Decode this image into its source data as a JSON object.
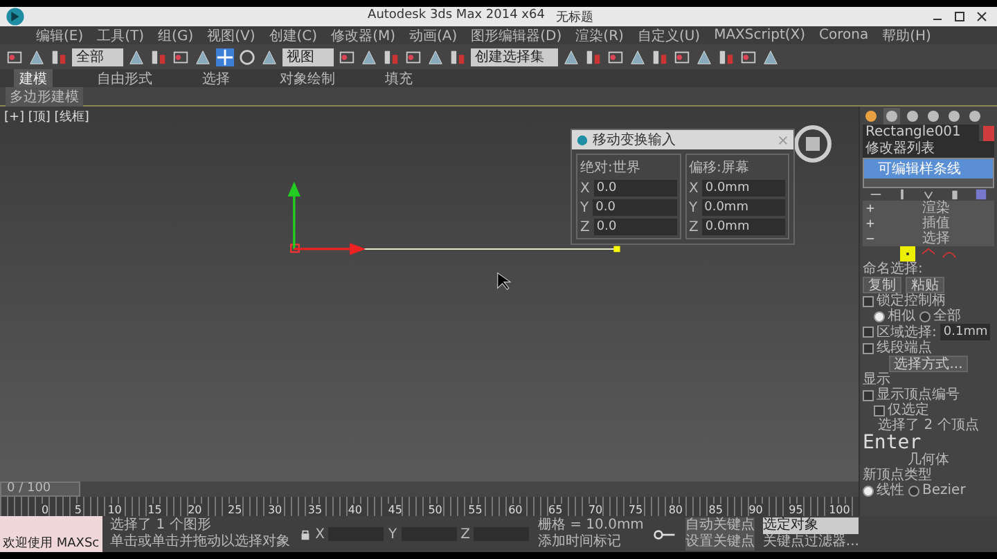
{
  "window": {
    "title": "Autodesk 3ds Max  2014 x64",
    "document": "无标题"
  },
  "menu": [
    "编辑(E)",
    "工具(T)",
    "组(G)",
    "视图(V)",
    "创建(C)",
    "修改器(M)",
    "动画(A)",
    "图形编辑器(D)",
    "渲染(R)",
    "自定义(U)",
    "MAXScript(X)",
    "Corona",
    "帮助(H)"
  ],
  "toolbar": {
    "filter": "全部",
    "coord": "视图",
    "selection_set": "创建选择集"
  },
  "ribbon": {
    "tabs": [
      {
        "label": "建模",
        "selected": true
      },
      {
        "label": "自由形式",
        "selected": false
      },
      {
        "label": "选择",
        "selected": false
      },
      {
        "label": "对象绘制",
        "selected": false
      },
      {
        "label": "填充",
        "selected": false
      }
    ],
    "subtitle": "多边形建模"
  },
  "viewport": {
    "label": "[+] [顶] [线框]"
  },
  "dialog": {
    "title": "移动变换输入",
    "groups": [
      {
        "title": "绝对:世界",
        "fields": [
          {
            "axis": "X",
            "value": "0.0"
          },
          {
            "axis": "Y",
            "value": "0.0"
          },
          {
            "axis": "Z",
            "value": "0.0"
          }
        ]
      },
      {
        "title": "偏移:屏幕",
        "fields": [
          {
            "axis": "X",
            "value": "0.0mm"
          },
          {
            "axis": "Y",
            "value": "0.0mm"
          },
          {
            "axis": "Z",
            "value": "0.0mm"
          }
        ]
      }
    ]
  },
  "panel": {
    "object_name": "Rectangle001",
    "modifier_list": "修改器列表",
    "stack": [
      {
        "label": "可编辑样条线",
        "selected": true
      }
    ],
    "rollouts": [
      {
        "label": "渲染",
        "expanded": false
      },
      {
        "label": "插值",
        "expanded": false
      },
      {
        "label": "选择",
        "expanded": true
      }
    ],
    "named_selection": "命名选择:",
    "copy": "复制",
    "paste": "粘贴",
    "lock_handles": {
      "label": "锁定控制柄",
      "checked": false
    },
    "handle_mode": [
      {
        "label": "相似",
        "selected": true
      },
      {
        "label": "全部",
        "selected": false
      }
    ],
    "area_select": {
      "label": "区域选择:",
      "checked": false,
      "value": "0.1mm"
    },
    "segment_end": {
      "label": "线段端点",
      "checked": false
    },
    "select_by": "选择方式...",
    "display": "显示",
    "show_numbers": {
      "label": "显示顶点编号",
      "checked": false
    },
    "selected_only": {
      "label": "仅选定",
      "checked": false
    },
    "status": "选择了 2 个顶点",
    "key_overlay": "Enter",
    "geometry": "几何体",
    "new_vertex_type": "新顶点类型",
    "vertex_types": [
      {
        "label": "线性",
        "selected": true
      },
      {
        "label": "Bezier",
        "selected": false
      }
    ]
  },
  "timeline": {
    "position": "0 / 100",
    "level": 0,
    "ticks": [
      "0",
      "5",
      "10",
      "15",
      "20",
      "25",
      "30",
      "35",
      "40",
      "45",
      "50",
      "55",
      "60",
      "65",
      "70",
      "75",
      "80",
      "85",
      "90",
      "95",
      "100"
    ]
  },
  "status_bar": {
    "welcome": "欢迎使用 MAXSc",
    "selected": "选择了 1 个图形",
    "prompt": "单击或单击并拖动以选择对象",
    "axes": [
      "X",
      "Y",
      "Z"
    ],
    "grid": "栅格 = 10.0mm",
    "add_time_tag": "添加时间标记",
    "auto_key": "自动关键点",
    "key_target": "选定对象",
    "set_key": "设置关键点",
    "key_filters": "关键点过滤器..."
  }
}
